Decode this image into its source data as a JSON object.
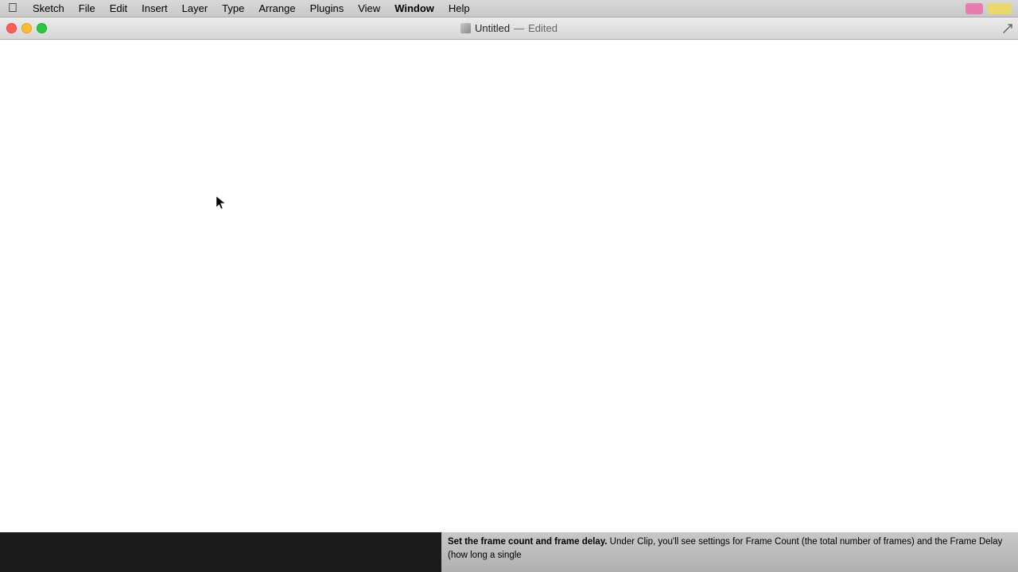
{
  "menubar": {
    "apple_symbol": "🍎",
    "items": [
      {
        "label": "Sketch",
        "active": true
      },
      {
        "label": "File"
      },
      {
        "label": "Edit"
      },
      {
        "label": "Insert"
      },
      {
        "label": "Layer"
      },
      {
        "label": "Type"
      },
      {
        "label": "Arrange"
      },
      {
        "label": "Plugins"
      },
      {
        "label": "View"
      },
      {
        "label": "Window",
        "active": false
      },
      {
        "label": "Help"
      }
    ],
    "right_icons": {
      "pink_color": "#e87cb0",
      "yellow_color": "#e8d96a"
    }
  },
  "titlebar": {
    "document_title": "Untitled",
    "separator": "—",
    "status": "Edited"
  },
  "bottom": {
    "text_bold": "Set the frame count and frame delay.",
    "text_normal": " Under Clip, you'll see settings for Frame Count (the total number of frames) and the Frame Delay (how long a single"
  }
}
